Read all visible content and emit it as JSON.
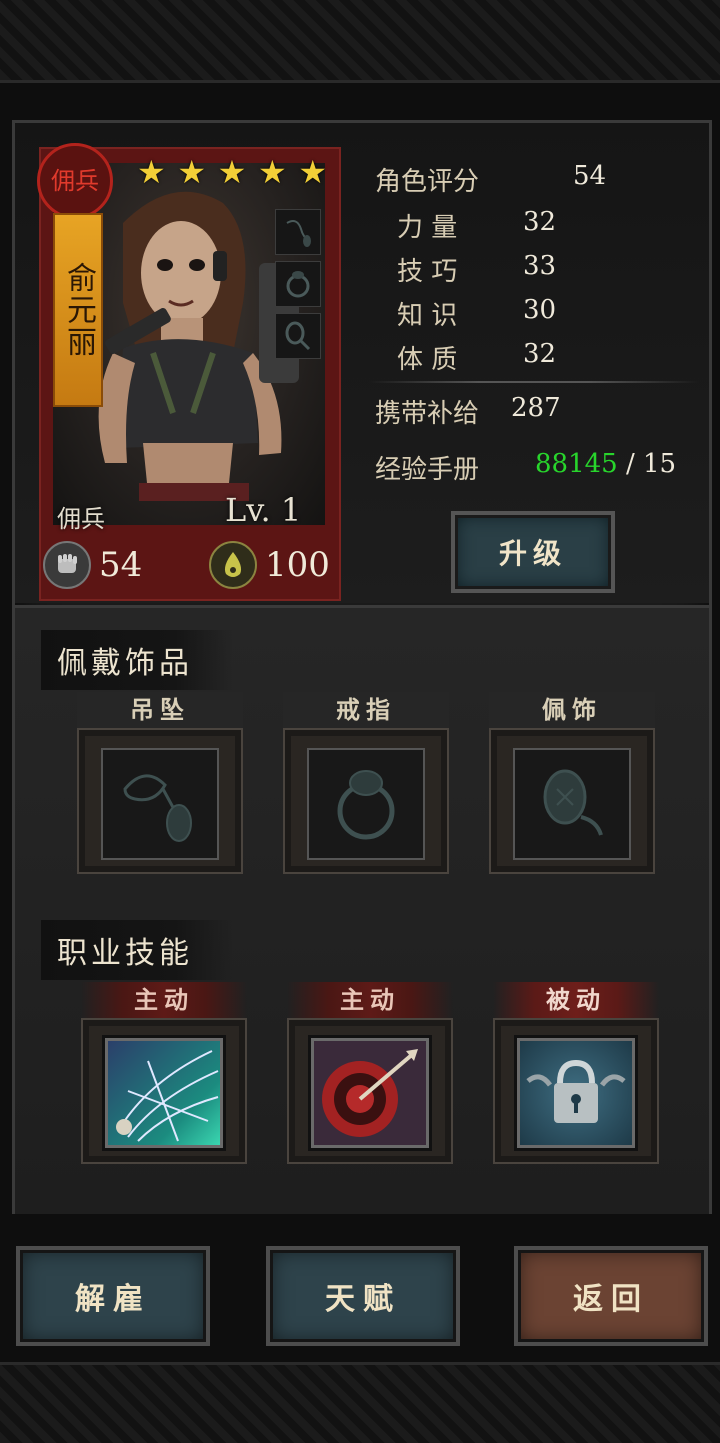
{
  "hero": {
    "class_seal": "佣兵",
    "name": "俞元丽",
    "stars": [
      "★",
      "★",
      "★",
      "★",
      "★"
    ],
    "class_label": "佣兵",
    "level": "Lv. 1",
    "hp": "54",
    "supply_stat": "100"
  },
  "stats": {
    "rating_label": "角色评分",
    "rating_value": "54",
    "strength_label": "力 量",
    "strength_value": "32",
    "skill_label": "技 巧",
    "skill_value": "33",
    "knowledge_label": "知 识",
    "knowledge_value": "30",
    "constitution_label": "体 质",
    "constitution_value": "32",
    "supplies_label": "携带补给",
    "supplies_value": "287",
    "exp_label": "经验手册",
    "exp_current": "88145",
    "exp_sep": " / ",
    "exp_required": "15",
    "upgrade_label": "升级"
  },
  "trinkets": {
    "title": "佩戴饰品",
    "slots": [
      {
        "label": "吊坠",
        "icon": "pendant-icon"
      },
      {
        "label": "戒指",
        "icon": "ring-icon"
      },
      {
        "label": "佩饰",
        "icon": "charm-icon"
      }
    ]
  },
  "skills": {
    "title": "职业技能",
    "slots": [
      {
        "label": "主动",
        "icon": "web-net-skill-icon"
      },
      {
        "label": "主动",
        "icon": "target-arrow-skill-icon"
      },
      {
        "label": "被动",
        "icon": "locked-chain-skill-icon"
      }
    ]
  },
  "buttons": {
    "dismiss": "解雇",
    "talent": "天赋",
    "back": "返回"
  },
  "colors": {
    "exp_current": "#28d52c",
    "card_red": "#5c1514",
    "button_blue": "#2e434b",
    "button_brown": "#6b4333",
    "star": "#f2cf37"
  }
}
